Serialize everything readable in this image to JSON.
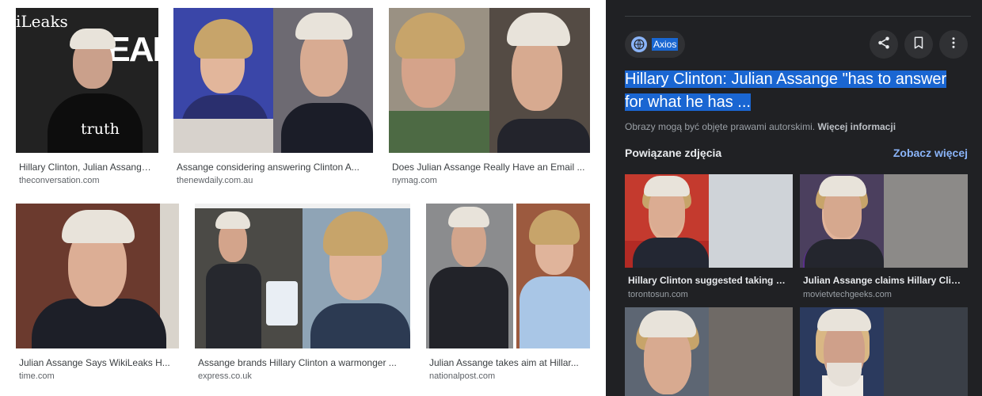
{
  "results": [
    {
      "title": "Hillary Clinton, Julian Assange ...",
      "source": "theconversation.com"
    },
    {
      "title": "Assange considering answering Clinton A...",
      "source": "thenewdaily.com.au"
    },
    {
      "title": "Does Julian Assange Really Have an Email ...",
      "source": "nymag.com"
    },
    {
      "title": "Julian Assange Says WikiLeaks H...",
      "source": "time.com"
    },
    {
      "title": "Assange brands Hillary Clinton a warmonger ...",
      "source": "express.co.uk"
    },
    {
      "title": "Julian Assange takes aim at Hillar...",
      "source": "nationalpost.com"
    }
  ],
  "thumb_text": {
    "wikileaks": "iLeaks",
    "year": "YEAR",
    "shirt": "truth"
  },
  "preview": {
    "source_label": "Axios",
    "title": "Hillary Clinton: Julian Assange \"has to answer for what he has ...",
    "copyright_text": "Obrazy mogą być objęte prawami autorskimi.",
    "more_info": "Więcej informacji",
    "related_heading": "Powiązane zdjęcia",
    "see_more": "Zobacz więcej",
    "icons": [
      "share-icon",
      "bookmark-icon",
      "more-vert-icon"
    ]
  },
  "related": [
    {
      "title": "Hillary Clinton suggested taking out...",
      "source": "torontosun.com"
    },
    {
      "title": "Julian Assange claims Hillary Clint...",
      "source": "movietvtechgeeks.com"
    },
    {
      "title": "",
      "source": ""
    },
    {
      "title": "",
      "source": ""
    }
  ],
  "colors": {
    "panel_bg": "#202124",
    "accent_link": "#8ab4f8",
    "selection": "#1a66d2"
  }
}
